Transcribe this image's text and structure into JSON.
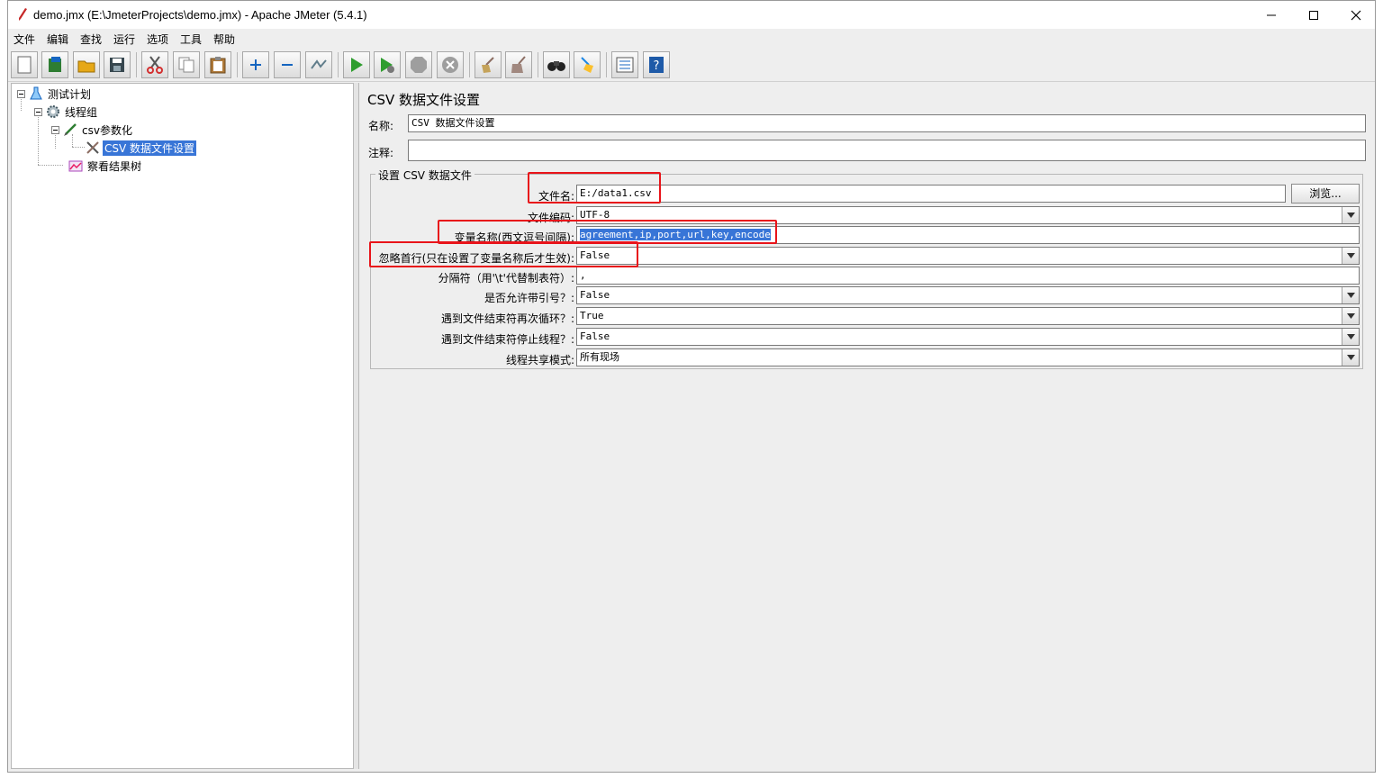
{
  "window": {
    "title": "demo.jmx (E:\\JmeterProjects\\demo.jmx) - Apache JMeter (5.4.1)"
  },
  "menu": [
    "文件",
    "编辑",
    "查找",
    "运行",
    "选项",
    "工具",
    "帮助"
  ],
  "toolbar": {
    "icons": [
      "new-icon",
      "templates-icon",
      "open-icon",
      "save-icon",
      "cut-icon",
      "copy-icon",
      "paste-icon",
      "expand-icon",
      "collapse-icon",
      "toggle-icon",
      "start-icon",
      "start-no-pause-icon",
      "stop-icon",
      "shutdown-icon",
      "clear-icon",
      "clear-all-icon",
      "search-icon",
      "reset-search-icon",
      "function-helper-icon",
      "help-icon"
    ]
  },
  "tree": {
    "items": [
      {
        "label": "测试计划"
      },
      {
        "label": "线程组"
      },
      {
        "label": "csv参数化"
      },
      {
        "label": "CSV 数据文件设置"
      },
      {
        "label": "察看结果树"
      }
    ]
  },
  "panel": {
    "title": "CSV 数据文件设置",
    "name_label": "名称:",
    "name_value": "CSV 数据文件设置",
    "comment_label": "注释:",
    "comment_value": "",
    "group_title": "设置 CSV 数据文件",
    "browse_label": "浏览...",
    "rows": [
      {
        "label": "文件名:",
        "value": "E:/data1.csv"
      },
      {
        "label": "文件编码:",
        "value": "UTF-8"
      },
      {
        "label": "变量名称(西文逗号间隔):",
        "value": "agreement,ip,port,url,key,encode"
      },
      {
        "label": "忽略首行(只在设置了变量名称后才生效):",
        "value": "False"
      },
      {
        "label": "分隔符（用'\\t'代替制表符）:",
        "value": ","
      },
      {
        "label": "是否允许带引号？:",
        "value": "False"
      },
      {
        "label": "遇到文件结束符再次循环？:",
        "value": "True"
      },
      {
        "label": "遇到文件结束符停止线程？:",
        "value": "False"
      },
      {
        "label": "线程共享模式:",
        "value": "所有现场"
      }
    ]
  },
  "colors": {
    "selection": "#3875d7",
    "highlight_box": "#e8141a"
  }
}
